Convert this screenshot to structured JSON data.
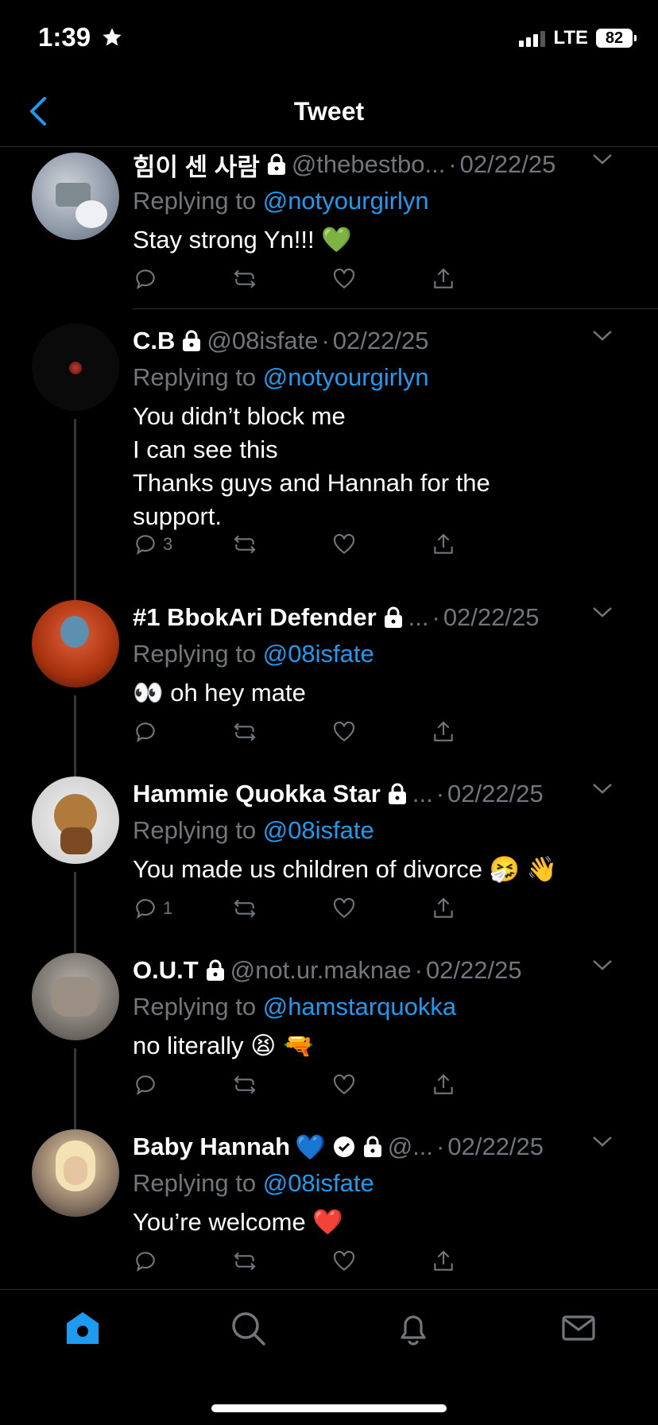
{
  "status_bar": {
    "time": "1:39",
    "network": "LTE",
    "battery": "82"
  },
  "header": {
    "title": "Tweet"
  },
  "tweets": [
    {
      "name": "힘이 센 사람",
      "handle": "@thebestbo...",
      "date": "02/22/25",
      "replying_prefix": "Replying to ",
      "replying_to": "@notyourgirlyn",
      "text": [
        "Stay strong Yn!!! 💚"
      ],
      "reply_count": ""
    },
    {
      "name": "C.B",
      "handle": "@08isfate",
      "date": "02/22/25",
      "replying_prefix": "Replying to ",
      "replying_to": "@notyourgirlyn",
      "text": [
        "You didn’t block me",
        "I can see this",
        "Thanks guys and Hannah for the",
        "support."
      ],
      "reply_count": "3"
    },
    {
      "name": "#1 BbokAri Defender",
      "handle": "...",
      "date": "02/22/25",
      "replying_prefix": "Replying to ",
      "replying_to": "@08isfate",
      "text": [
        "👀 oh hey mate"
      ],
      "reply_count": ""
    },
    {
      "name": "Hammie Quokka Star",
      "handle": "...",
      "date": "02/22/25",
      "replying_prefix": "Replying to ",
      "replying_to": "@08isfate",
      "text": [
        "You made us children of divorce 🤧 👋"
      ],
      "reply_count": "1"
    },
    {
      "name": "O.U.T",
      "handle": "@not.ur.maknae",
      "date": "02/22/25",
      "replying_prefix": "Replying to ",
      "replying_to": "@hamstarquokka",
      "text": [
        "no literally 😫 🔫"
      ],
      "reply_count": ""
    },
    {
      "name": "Baby Hannah",
      "name_emoji": "💙",
      "handle": "@...",
      "date": "02/22/25",
      "replying_prefix": "Replying to ",
      "replying_to": "@08isfate",
      "text": [
        "You’re welcome ❤️"
      ],
      "reply_count": ""
    }
  ],
  "dot_separator": "·",
  "icons": {
    "back": "chevron-left-icon",
    "lock": "lock-icon",
    "verified": "verified-badge-icon",
    "reply": "reply-icon",
    "retweet": "retweet-icon",
    "like": "heart-icon",
    "share": "share-icon",
    "more": "chevron-down-icon",
    "home": "home-icon",
    "search": "search-icon",
    "notifications": "bell-icon",
    "messages": "mail-icon"
  },
  "colors": {
    "background": "#000000",
    "accent": "#1d9bf0",
    "muted": "#71767b",
    "text": "#ffffff"
  }
}
